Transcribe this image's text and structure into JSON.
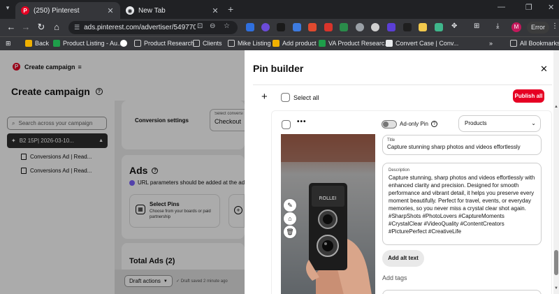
{
  "browser": {
    "tabs": [
      {
        "title": "(250) Pinterest",
        "active": true,
        "icon": "pinterest-icon"
      },
      {
        "title": "New Tab",
        "active": false,
        "icon": "chrome-icon"
      }
    ],
    "url": "ads.pinterest.com/advertiser/549770...",
    "profile_initial": "M",
    "error_label": "Error",
    "bookmarks": [
      {
        "label": "Back",
        "color": "#f0b000"
      },
      {
        "label": "Product Listing - Au...",
        "color": "#1e9e4a"
      },
      {
        "label": "",
        "color": "#ffffff"
      },
      {
        "label": "Product Research",
        "color": "#cfcfcf"
      },
      {
        "label": "Clients",
        "color": "#cfcfcf"
      },
      {
        "label": "Mike Listing",
        "color": "#cfcfcf"
      },
      {
        "label": "Add product",
        "color": "#f0b000"
      },
      {
        "label": "VA Product Researc...",
        "color": "#1e9e4a"
      },
      {
        "label": "Convert Case | Conv...",
        "color": "#e8eaed"
      },
      {
        "label": "All Bookmarks",
        "color": "#cfcfcf"
      }
    ]
  },
  "left": {
    "brand": "Create campaign",
    "page_title": "Create campaign",
    "search_placeholder": "Search across your campaign",
    "campaign": "B2 15P| 2026-03-10...",
    "ads": [
      "Conversions Ad | Read...",
      "Conversions Ad | Read..."
    ],
    "conversion_label": "Conversion settings",
    "conversion_select_label": "Select conversi",
    "conversion_select_value": "Checkout",
    "ads_title": "Ads",
    "url_note": "URL parameters should be added at the ad group",
    "select_pins_title": "Select Pins",
    "select_pins_desc": "Choose from your boards or paid partnership",
    "total_ads": "Total Ads (2)",
    "draft_actions": "Draft actions",
    "draft_status": "Draft saved 2 minute ago"
  },
  "pin_builder": {
    "title": "Pin builder",
    "select_all": "Select all",
    "publish_label": "Publish all",
    "ad_only_label": "Ad-only Pin",
    "ad_only_enabled": false,
    "products_value": "Products",
    "title_label": "Title",
    "title_value": "Capture stunning sharp photos and videos effortlessly",
    "description_label": "Description",
    "description_value": "Capture stunning, sharp photos and videos effortlessly with enhanced clarity and precision. Designed for smooth performance and vibrant detail, it helps you preserve every moment beautifully. Perfect for travel, events, or everyday memories, so you never miss a crystal clear shot again. #SharpShots #PhotoLovers #CaptureMoments #CrystalClear #VideoQuality #ContentCreators #PicturePerfect #CreativeLife",
    "alt_text_label": "Add alt text",
    "add_tags_label": "Add tags",
    "camera_label": "ROLLEI"
  },
  "colors": {
    "accent": "#e60023",
    "toggle_track": "#e0e0e0"
  }
}
